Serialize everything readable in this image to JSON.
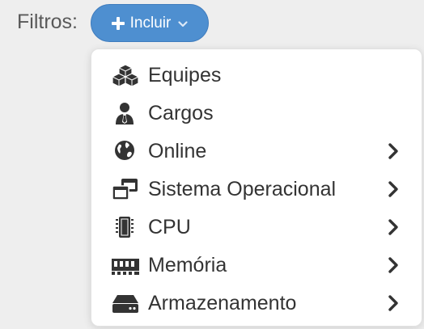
{
  "filters": {
    "label": "Filtros:",
    "include_button": {
      "label": "Incluir",
      "color": "#4e8fd0"
    }
  },
  "menu": {
    "items": [
      {
        "label": "Equipes",
        "icon": "cubes-icon",
        "has_submenu": false
      },
      {
        "label": "Cargos",
        "icon": "user-tie-icon",
        "has_submenu": false
      },
      {
        "label": "Online",
        "icon": "globe-icon",
        "has_submenu": true
      },
      {
        "label": "Sistema Operacional",
        "icon": "windows-restore-icon",
        "has_submenu": true
      },
      {
        "label": "CPU",
        "icon": "microchip-icon",
        "has_submenu": true
      },
      {
        "label": "Memória",
        "icon": "memory-icon",
        "has_submenu": true
      },
      {
        "label": "Armazenamento",
        "icon": "hdd-icon",
        "has_submenu": true
      }
    ]
  }
}
